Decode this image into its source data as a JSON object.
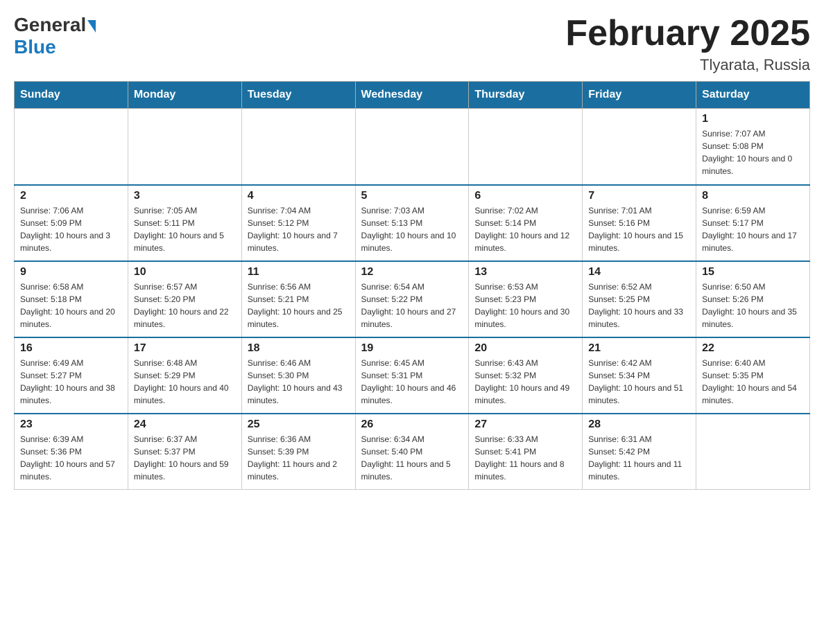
{
  "header": {
    "logo_general": "General",
    "logo_blue": "Blue",
    "month_title": "February 2025",
    "location": "Tlyarata, Russia"
  },
  "days_of_week": [
    "Sunday",
    "Monday",
    "Tuesday",
    "Wednesday",
    "Thursday",
    "Friday",
    "Saturday"
  ],
  "weeks": [
    {
      "days": [
        {
          "date": "",
          "info": ""
        },
        {
          "date": "",
          "info": ""
        },
        {
          "date": "",
          "info": ""
        },
        {
          "date": "",
          "info": ""
        },
        {
          "date": "",
          "info": ""
        },
        {
          "date": "",
          "info": ""
        },
        {
          "date": "1",
          "info": "Sunrise: 7:07 AM\nSunset: 5:08 PM\nDaylight: 10 hours and 0 minutes."
        }
      ]
    },
    {
      "days": [
        {
          "date": "2",
          "info": "Sunrise: 7:06 AM\nSunset: 5:09 PM\nDaylight: 10 hours and 3 minutes."
        },
        {
          "date": "3",
          "info": "Sunrise: 7:05 AM\nSunset: 5:11 PM\nDaylight: 10 hours and 5 minutes."
        },
        {
          "date": "4",
          "info": "Sunrise: 7:04 AM\nSunset: 5:12 PM\nDaylight: 10 hours and 7 minutes."
        },
        {
          "date": "5",
          "info": "Sunrise: 7:03 AM\nSunset: 5:13 PM\nDaylight: 10 hours and 10 minutes."
        },
        {
          "date": "6",
          "info": "Sunrise: 7:02 AM\nSunset: 5:14 PM\nDaylight: 10 hours and 12 minutes."
        },
        {
          "date": "7",
          "info": "Sunrise: 7:01 AM\nSunset: 5:16 PM\nDaylight: 10 hours and 15 minutes."
        },
        {
          "date": "8",
          "info": "Sunrise: 6:59 AM\nSunset: 5:17 PM\nDaylight: 10 hours and 17 minutes."
        }
      ]
    },
    {
      "days": [
        {
          "date": "9",
          "info": "Sunrise: 6:58 AM\nSunset: 5:18 PM\nDaylight: 10 hours and 20 minutes."
        },
        {
          "date": "10",
          "info": "Sunrise: 6:57 AM\nSunset: 5:20 PM\nDaylight: 10 hours and 22 minutes."
        },
        {
          "date": "11",
          "info": "Sunrise: 6:56 AM\nSunset: 5:21 PM\nDaylight: 10 hours and 25 minutes."
        },
        {
          "date": "12",
          "info": "Sunrise: 6:54 AM\nSunset: 5:22 PM\nDaylight: 10 hours and 27 minutes."
        },
        {
          "date": "13",
          "info": "Sunrise: 6:53 AM\nSunset: 5:23 PM\nDaylight: 10 hours and 30 minutes."
        },
        {
          "date": "14",
          "info": "Sunrise: 6:52 AM\nSunset: 5:25 PM\nDaylight: 10 hours and 33 minutes."
        },
        {
          "date": "15",
          "info": "Sunrise: 6:50 AM\nSunset: 5:26 PM\nDaylight: 10 hours and 35 minutes."
        }
      ]
    },
    {
      "days": [
        {
          "date": "16",
          "info": "Sunrise: 6:49 AM\nSunset: 5:27 PM\nDaylight: 10 hours and 38 minutes."
        },
        {
          "date": "17",
          "info": "Sunrise: 6:48 AM\nSunset: 5:29 PM\nDaylight: 10 hours and 40 minutes."
        },
        {
          "date": "18",
          "info": "Sunrise: 6:46 AM\nSunset: 5:30 PM\nDaylight: 10 hours and 43 minutes."
        },
        {
          "date": "19",
          "info": "Sunrise: 6:45 AM\nSunset: 5:31 PM\nDaylight: 10 hours and 46 minutes."
        },
        {
          "date": "20",
          "info": "Sunrise: 6:43 AM\nSunset: 5:32 PM\nDaylight: 10 hours and 49 minutes."
        },
        {
          "date": "21",
          "info": "Sunrise: 6:42 AM\nSunset: 5:34 PM\nDaylight: 10 hours and 51 minutes."
        },
        {
          "date": "22",
          "info": "Sunrise: 6:40 AM\nSunset: 5:35 PM\nDaylight: 10 hours and 54 minutes."
        }
      ]
    },
    {
      "days": [
        {
          "date": "23",
          "info": "Sunrise: 6:39 AM\nSunset: 5:36 PM\nDaylight: 10 hours and 57 minutes."
        },
        {
          "date": "24",
          "info": "Sunrise: 6:37 AM\nSunset: 5:37 PM\nDaylight: 10 hours and 59 minutes."
        },
        {
          "date": "25",
          "info": "Sunrise: 6:36 AM\nSunset: 5:39 PM\nDaylight: 11 hours and 2 minutes."
        },
        {
          "date": "26",
          "info": "Sunrise: 6:34 AM\nSunset: 5:40 PM\nDaylight: 11 hours and 5 minutes."
        },
        {
          "date": "27",
          "info": "Sunrise: 6:33 AM\nSunset: 5:41 PM\nDaylight: 11 hours and 8 minutes."
        },
        {
          "date": "28",
          "info": "Sunrise: 6:31 AM\nSunset: 5:42 PM\nDaylight: 11 hours and 11 minutes."
        },
        {
          "date": "",
          "info": ""
        }
      ]
    }
  ]
}
